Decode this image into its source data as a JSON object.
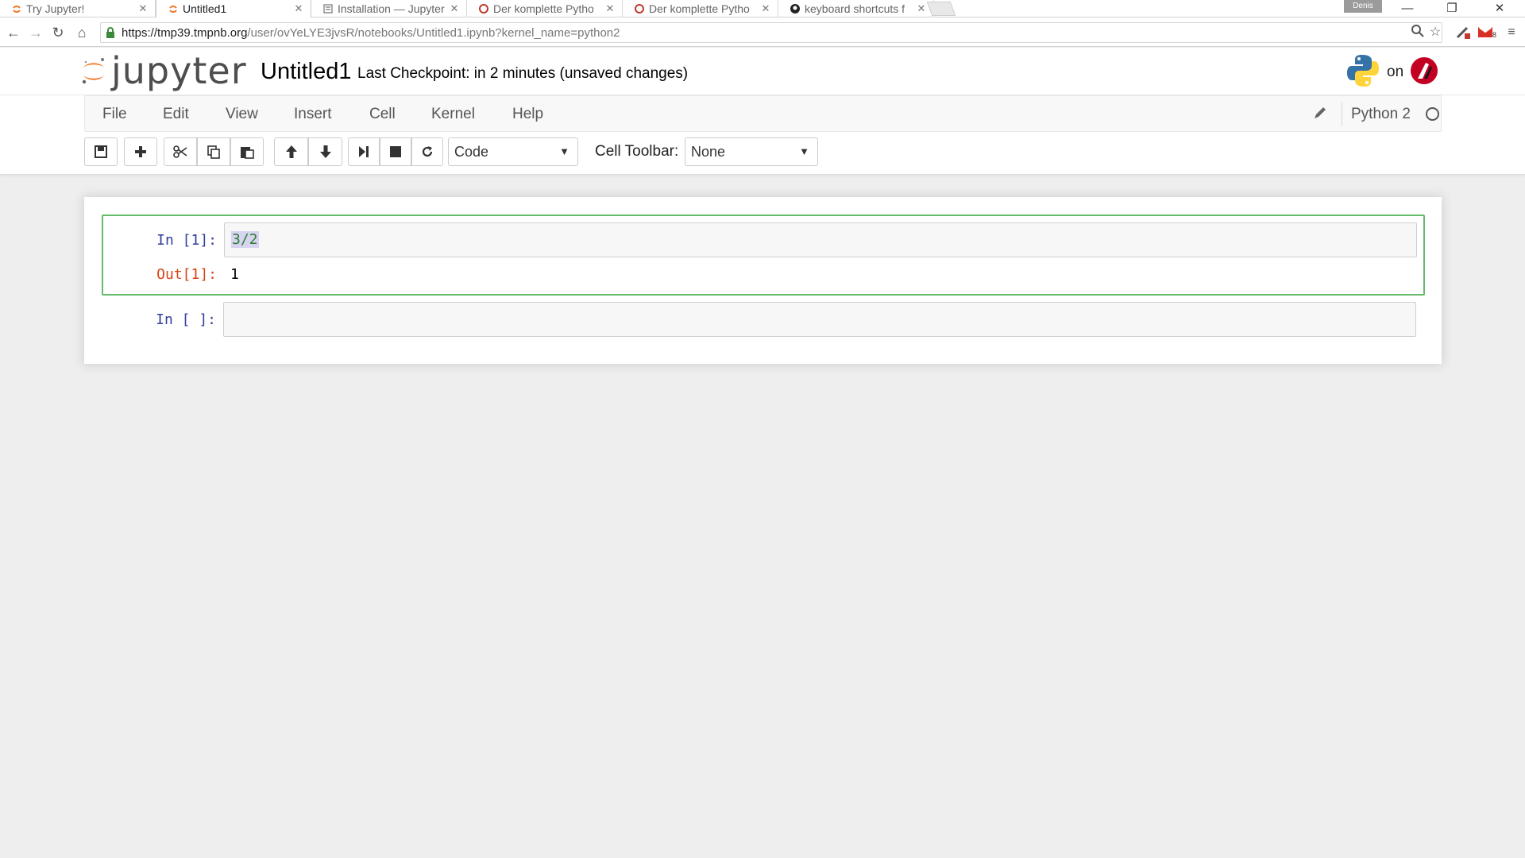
{
  "browser": {
    "tabs": [
      {
        "label": "Try Jupyter!",
        "active": false
      },
      {
        "label": "Untitled1",
        "active": true
      },
      {
        "label": "Installation — Jupyter",
        "active": false
      },
      {
        "label": "Der komplette Pytho",
        "active": false
      },
      {
        "label": "Der komplette Pytho",
        "active": false
      },
      {
        "label": "keyboard shortcuts f",
        "active": false
      }
    ],
    "profile": "Denis",
    "url_host": "https://tmp39.tmpnb.org",
    "url_path": "/user/ovYeLYE3jvsR/notebooks/Untitled1.ipynb?kernel_name=python2",
    "ext_badge": "8"
  },
  "header": {
    "logo_text": "jupyter",
    "notebook_name": "Untitled1",
    "checkpoint": "Last Checkpoint: in 2 minutes (unsaved changes)",
    "brand_on": "on"
  },
  "menubar": {
    "items": [
      "File",
      "Edit",
      "View",
      "Insert",
      "Cell",
      "Kernel",
      "Help"
    ],
    "kernel_name": "Python 2"
  },
  "toolbar": {
    "cell_type": "Code",
    "cell_toolbar_label": "Cell Toolbar:",
    "cell_toolbar_value": "None"
  },
  "cells": [
    {
      "in_prompt": "In [1]:",
      "code": "3/2",
      "out_prompt": "Out[1]:",
      "output": "1"
    },
    {
      "in_prompt": "In [ ]:",
      "code": ""
    }
  ],
  "colors": {
    "in_prompt": "#303f9f",
    "out_prompt": "#d84315",
    "selected_border": "#66bb6a",
    "jupyter_orange": "#f37726"
  }
}
